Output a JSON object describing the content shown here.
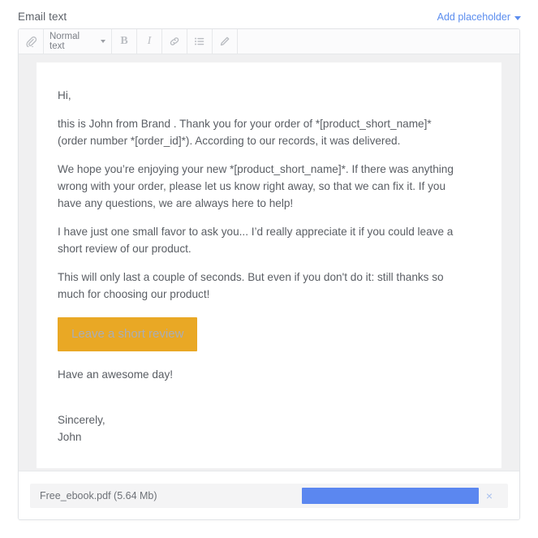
{
  "field": {
    "label": "Email text",
    "add_placeholder_label": "Add placeholder",
    "caret_icon": "chevron-down-icon"
  },
  "toolbar": {
    "attach_icon": "paperclip-icon",
    "style_select_value": "Normal text",
    "style_select_caret": "chevron-down-icon",
    "bold_label": "B",
    "italic_label": "I",
    "link_icon": "link-icon",
    "list_icon": "bulleted-list-icon",
    "edit_icon": "pencil-icon"
  },
  "email": {
    "paragraphs": [
      "Hi,",
      "this is John from Brand . Thank you for your order of *[product_short_name]* (order number *[order_id]*). According to our records, it was delivered.",
      "We hope you’re enjoying your new *[product_short_name]*. If there was anything wrong with your order, please let us know right away, so that we can fix it. If you have any questions, we are always here to help!",
      "I have just one small favor to ask you... I’d really appreciate it if you could leave a short review of our product.",
      "This will only last a couple of seconds. But even if you don't do it: still thanks so much for choosing our product!"
    ],
    "cta_label": "Leave a short review",
    "closing": "Have an awesome day!",
    "signoff": "Sincerely,",
    "signature": "John"
  },
  "attachment": {
    "file_label": "Free_ebook.pdf (5.64 Mb)",
    "progress_percent": 100,
    "remove_label": "×",
    "remove_icon": "close-icon"
  },
  "colors": {
    "link_blue": "#5b8def",
    "cta_orange": "#e9a825",
    "cta_text": "#a9aeb8",
    "progress_blue": "#5b87f0",
    "body_text": "#5a5e64",
    "canvas_gray": "#f0f0f1",
    "border_gray": "#e2e4e7"
  }
}
